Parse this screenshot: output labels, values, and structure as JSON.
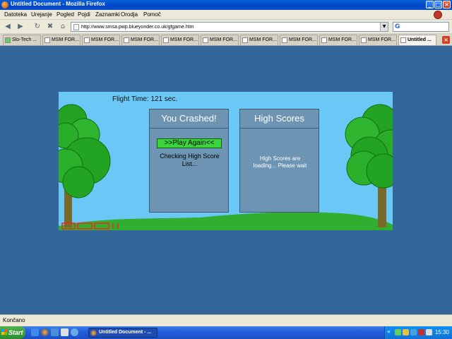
{
  "window": {
    "title": "Untitled Document - Mozilla Firefox"
  },
  "menu": [
    "Datoteka",
    "Urejanje",
    "Pogled",
    "Pojdi",
    "Zaznamki",
    "Orodja",
    "Pomoč"
  ],
  "address": {
    "url": "http://www.smsa.pwp.blueyonder.co.uk/gfgame.htm"
  },
  "tabs": [
    {
      "label": "Slo-Tech ..."
    },
    {
      "label": "MSM FOR..."
    },
    {
      "label": "MSM FOR..."
    },
    {
      "label": "MSM FOR..."
    },
    {
      "label": "MSM FOR..."
    },
    {
      "label": "MSM FOR..."
    },
    {
      "label": "MSM FOR..."
    },
    {
      "label": "MSM FOR..."
    },
    {
      "label": "MSM FOR..."
    },
    {
      "label": "MSM FOR..."
    },
    {
      "label": "Untitled ..."
    }
  ],
  "game": {
    "flight_time": "Flight Time: 121 sec.",
    "crash_title": "You Crashed!",
    "play_again": ">>Play Again<<",
    "checking": "Checking High Score List...",
    "scores_title": "High Scores",
    "scores_loading": "High Scores are loading... Please wait",
    "colors": {
      "sky": "#6bc7f5",
      "grass": "#2fae2f",
      "foliage": "#22a322",
      "trunk": "#7a6a2a",
      "panel": "#6e94b4",
      "button": "#3cd43c",
      "train": "#ff2020"
    }
  },
  "status": {
    "text": "Končano"
  },
  "taskbar": {
    "start_label": "Start",
    "task_item": "Untitled Document - ...",
    "clock": "15:30"
  },
  "icons": [
    "back-icon",
    "forward-icon",
    "reload-icon",
    "stop-icon",
    "home-icon",
    "search-engine-icon",
    "minimize-icon",
    "maximize-icon",
    "close-icon"
  ]
}
